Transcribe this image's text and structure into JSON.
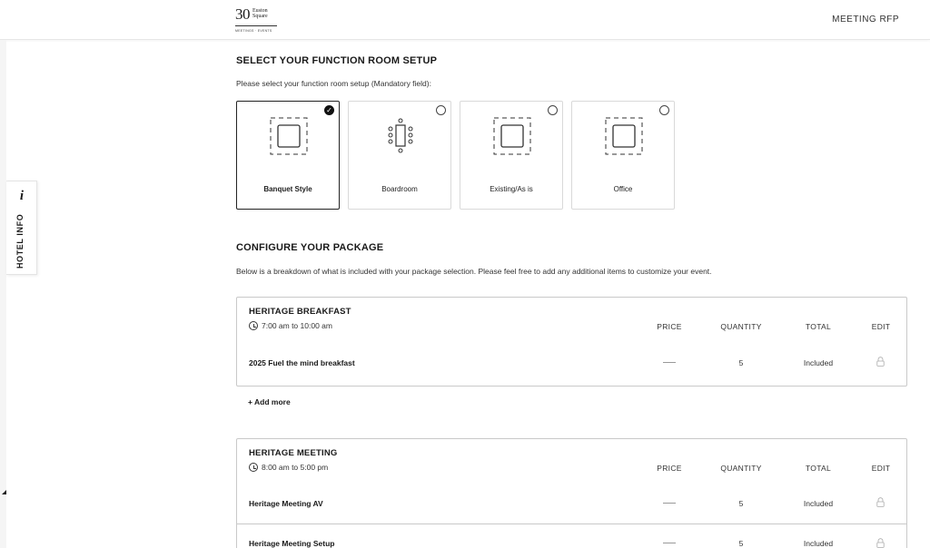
{
  "header": {
    "logo": {
      "number": "30",
      "line1": "Euston",
      "line2": "Square",
      "tagline": "MEETINGS · EVENTS"
    },
    "nav_label": "MEETING RFP"
  },
  "hotel_tab": {
    "icon": "info-icon",
    "icon_glyph": "i",
    "label": "HOTEL INFO"
  },
  "setup": {
    "heading": "SELECT YOUR FUNCTION ROOM SETUP",
    "subtext": "Please select your function room setup (Mandatory field):",
    "options": [
      {
        "label": "Banquet Style",
        "selected": true,
        "icon": "banquet-style-icon"
      },
      {
        "label": "Boardroom",
        "selected": false,
        "icon": "boardroom-icon"
      },
      {
        "label": "Existing/As is",
        "selected": false,
        "icon": "existing-as-is-icon"
      },
      {
        "label": "Office",
        "selected": false,
        "icon": "office-icon"
      }
    ],
    "check_glyph": "✓"
  },
  "package": {
    "heading": "CONFIGURE YOUR PACKAGE",
    "subtext": "Below is a breakdown of what is included with your package selection. Please feel free to add any additional items to customize your event.",
    "columns": {
      "price": "PRICE",
      "quantity": "QUANTITY",
      "total": "TOTAL",
      "edit": "EDIT"
    },
    "sections": [
      {
        "title": "HERITAGE BREAKFAST",
        "time": "7:00 am to 10:00 am",
        "items": [
          {
            "name": "2025 Fuel the mind breakfast",
            "quantity": "5",
            "total": "Included"
          }
        ]
      },
      {
        "title": "HERITAGE MEETING",
        "time": "8:00 am to 5:00 pm",
        "items": [
          {
            "name": "Heritage Meeting AV",
            "quantity": "5",
            "total": "Included"
          },
          {
            "name": "Heritage Meeting Setup",
            "quantity": "5",
            "total": "Included"
          }
        ]
      }
    ],
    "add_more": "+ Add more"
  }
}
